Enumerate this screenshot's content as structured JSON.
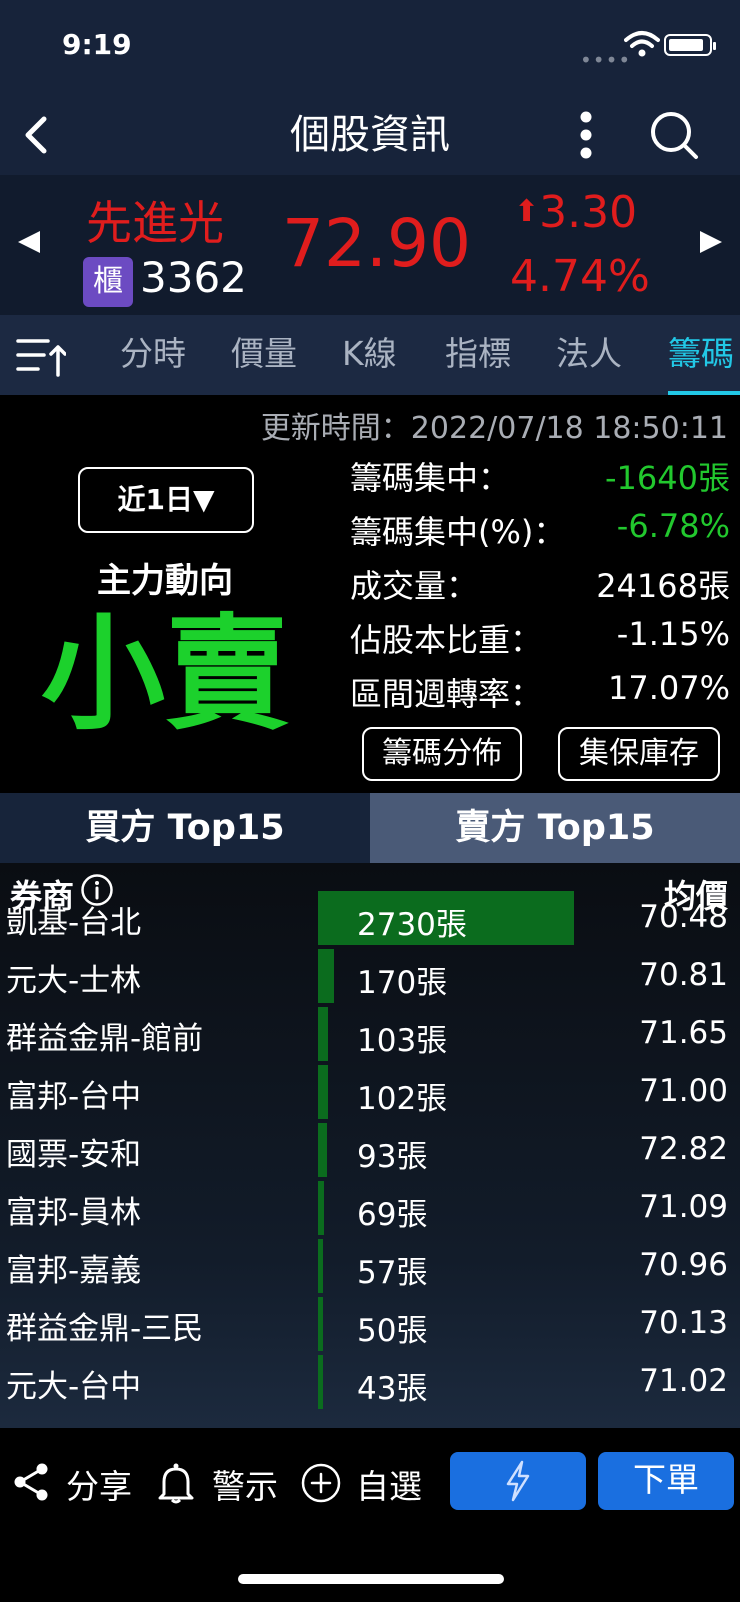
{
  "status_bar": {
    "time": "9:19"
  },
  "header": {
    "title": "個股資訊"
  },
  "quote": {
    "name": "先進光",
    "market_badge": "櫃",
    "code": "3362",
    "price": "72.90",
    "change": "3.30",
    "change_pct": "4.74%",
    "up_color": "#e01d1d"
  },
  "tabs": [
    {
      "label": "分時"
    },
    {
      "label": "價量"
    },
    {
      "label": "K線"
    },
    {
      "label": "指標"
    },
    {
      "label": "法人"
    },
    {
      "label": "籌碼",
      "active": true
    }
  ],
  "chip": {
    "update_time": "更新時間：2022/07/18 18:50:11",
    "period": "近1日▼",
    "main_force_label": "主力動向",
    "signal": "小賣",
    "stats": [
      {
        "label": "籌碼集中：",
        "value": "-1640張",
        "color": "green"
      },
      {
        "label": "籌碼集中(%)：",
        "value": "-6.78%",
        "color": "green"
      },
      {
        "label": "成交量：",
        "value": "24168張",
        "color": "white"
      },
      {
        "label": "佔股本比重：",
        "value": "-1.15%",
        "color": "white"
      },
      {
        "label": "區間週轉率：",
        "value": "17.07%",
        "color": "white"
      }
    ],
    "distribution_button": "籌碼分佈",
    "custody_button": "集保庫存"
  },
  "buyer_tab": "買方 Top15",
  "seller_tab": "賣方 Top15",
  "table": {
    "col_broker": "券商",
    "col_avg": "均價",
    "rows": [
      {
        "broker": "凱基-台北",
        "volume": 2730,
        "volume_text": "2730張",
        "avg": "70.48"
      },
      {
        "broker": "元大-士林",
        "volume": 170,
        "volume_text": "170張",
        "avg": "70.81"
      },
      {
        "broker": "群益金鼎-館前",
        "volume": 103,
        "volume_text": "103張",
        "avg": "71.65"
      },
      {
        "broker": "富邦-台中",
        "volume": 102,
        "volume_text": "102張",
        "avg": "71.00"
      },
      {
        "broker": "國票-安和",
        "volume": 93,
        "volume_text": "93張",
        "avg": "72.82"
      },
      {
        "broker": "富邦-員林",
        "volume": 69,
        "volume_text": "69張",
        "avg": "71.09"
      },
      {
        "broker": "富邦-嘉義",
        "volume": 57,
        "volume_text": "57張",
        "avg": "70.96"
      },
      {
        "broker": "群益金鼎-三民",
        "volume": 50,
        "volume_text": "50張",
        "avg": "70.13"
      },
      {
        "broker": "元大-台中",
        "volume": 43,
        "volume_text": "43張",
        "avg": "71.02"
      }
    ]
  },
  "bottom_bar": {
    "share": "分享",
    "alert": "警示",
    "watchlist": "自選",
    "order": "下單"
  }
}
